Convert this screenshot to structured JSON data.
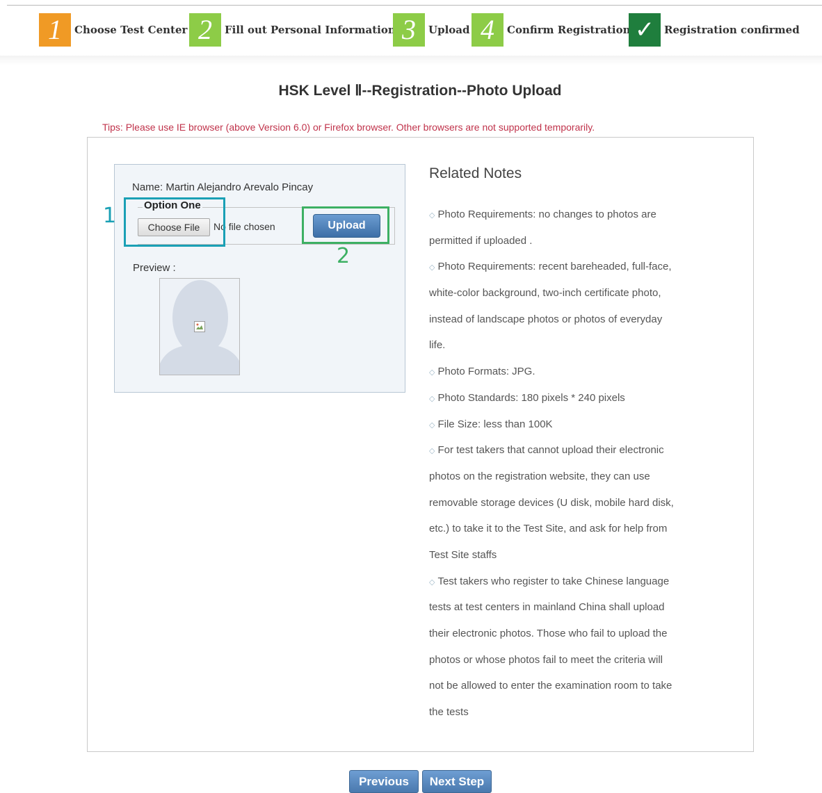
{
  "steps": [
    {
      "number": "1",
      "label": "Choose Test Center",
      "color": "#f09a25"
    },
    {
      "number": "2",
      "label": "Fill out Personal Information",
      "color": "#8dcc47"
    },
    {
      "number": "3",
      "label": "Upload",
      "color": "#8dcc47"
    },
    {
      "number": "4",
      "label": "Confirm Registration",
      "color": "#8dcc47"
    },
    {
      "number": "✓",
      "label": "Registration confirmed",
      "color": "#1f7e3d"
    }
  ],
  "page_title": "HSK Level Ⅱ--Registration--Photo Upload",
  "tips": "Tips: Please use IE browser (above Version 6.0) or Firefox browser. Other browsers are not supported temporarily.",
  "upload_form": {
    "name_line": "Name: Martin Alejandro Arevalo Pincay",
    "legend": "Option One",
    "choose_file_label": "Choose File",
    "no_file_text": "No file chosen",
    "upload_label": "Upload",
    "preview_label": "Preview :"
  },
  "annotations": {
    "marker_1": "1",
    "marker_2": "2",
    "marker_1_color": "#1aa0b5",
    "marker_2_color": "#3db063"
  },
  "related_notes": {
    "title": "Related Notes",
    "lines": [
      {
        "bullet": true,
        "text": "Photo Requirements: no changes to photos are"
      },
      {
        "bullet": false,
        "text": "permitted if uploaded ."
      },
      {
        "bullet": true,
        "text": "Photo Requirements: recent bareheaded, full-face,"
      },
      {
        "bullet": false,
        "text": "white-color background, two-inch certificate photo,"
      },
      {
        "bullet": false,
        "text": "instead of landscape photos or photos of everyday"
      },
      {
        "bullet": false,
        "text": "life."
      },
      {
        "bullet": true,
        "text": "Photo Formats: JPG."
      },
      {
        "bullet": true,
        "text": "Photo Standards: 180 pixels * 240 pixels"
      },
      {
        "bullet": true,
        "text": "File Size: less than 100K"
      },
      {
        "bullet": true,
        "text": "For test takers that cannot upload their electronic"
      },
      {
        "bullet": false,
        "text": "photos on the registration website, they can use"
      },
      {
        "bullet": false,
        "text": "removable storage devices (U disk, mobile hard disk,"
      },
      {
        "bullet": false,
        "text": "etc.) to take it to the Test Site, and ask for help from"
      },
      {
        "bullet": false,
        "text": "Test Site staffs"
      },
      {
        "bullet": true,
        "text": "Test takers who register to take Chinese language"
      },
      {
        "bullet": false,
        "text": "tests at test centers in mainland China shall upload"
      },
      {
        "bullet": false,
        "text": "their electronic photos. Those who fail to upload the"
      },
      {
        "bullet": false,
        "text": "photos or whose photos fail to meet the criteria will"
      },
      {
        "bullet": false,
        "text": "not be allowed to enter the examination room to take"
      },
      {
        "bullet": false,
        "text": "the tests"
      }
    ]
  },
  "nav": {
    "previous_label": "Previous",
    "next_label": "Next Step"
  }
}
